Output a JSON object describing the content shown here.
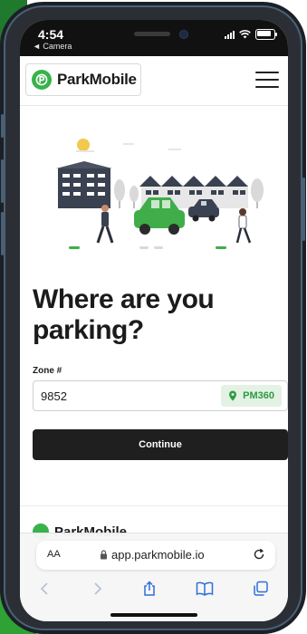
{
  "status_bar": {
    "time": "4:54",
    "back_label": "◄ Camera"
  },
  "header": {
    "logo_text": "ParkMobile",
    "logo_glyph": "P",
    "brand_color": "#38b24a"
  },
  "hero": {
    "heading_line1": "Where are you",
    "heading_line2": "parking?"
  },
  "zone": {
    "label": "Zone #",
    "value": "9852",
    "badge_text": "PM360",
    "badge_color": "#2e9c3e"
  },
  "continue_button": {
    "label": "Continue"
  },
  "footer": {
    "logo_text": "ParkMobile"
  },
  "safari": {
    "text_size_label": "AA",
    "url": "app.parkmobile.io"
  }
}
